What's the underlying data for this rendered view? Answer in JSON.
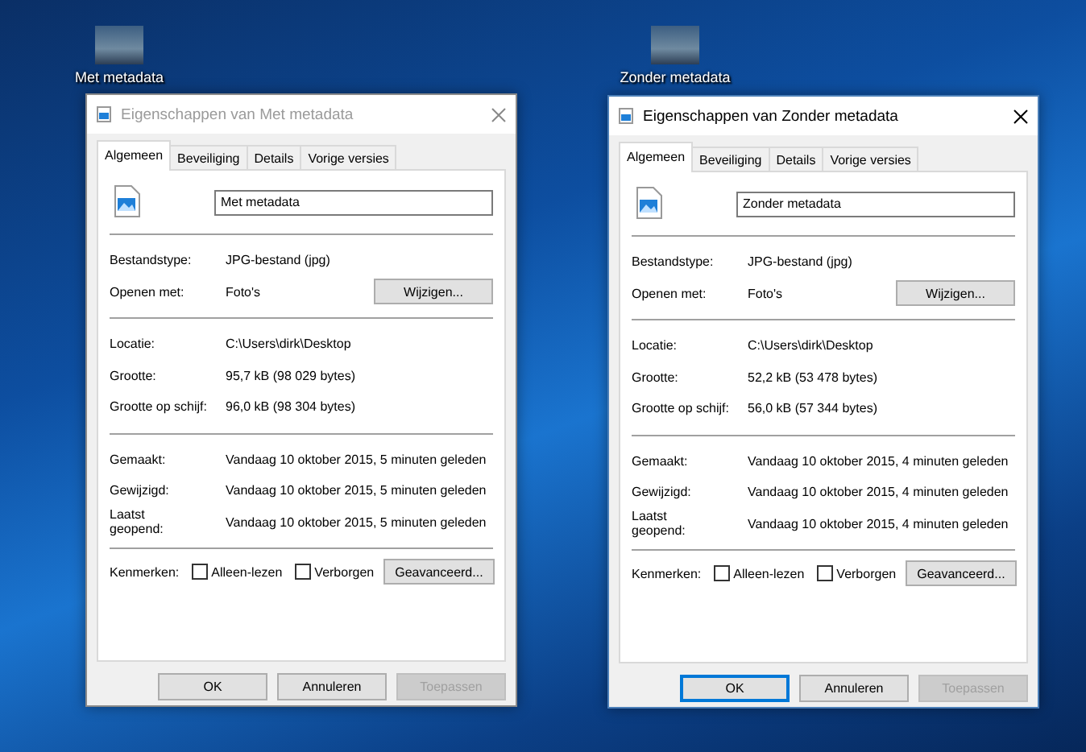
{
  "desktop_icons": [
    {
      "label": "Met metadata"
    },
    {
      "label": "Zonder metadata"
    }
  ],
  "windows": [
    {
      "title": "Eigenschappen van Met metadata",
      "active": false,
      "tabs": [
        {
          "label": "Algemeen",
          "selected": true
        },
        {
          "label": "Beveiliging",
          "selected": false
        },
        {
          "label": "Details",
          "selected": false
        },
        {
          "label": "Vorige versies",
          "selected": false
        }
      ],
      "name_field": {
        "value": "Met metadata"
      },
      "sections": [
        [
          {
            "label": "Bestandstype:",
            "value": "JPG-bestand (jpg)"
          },
          {
            "label": "Openen met:",
            "value": "Foto's",
            "button": "Wijzigen..."
          }
        ],
        [
          {
            "label": "Locatie:",
            "value": "C:\\Users\\dirk\\Desktop"
          },
          {
            "label": "Grootte:",
            "value": "95,7 kB (98 029 bytes)"
          },
          {
            "label": "Grootte op schijf:",
            "value": "96,0 kB (98 304 bytes)"
          }
        ],
        [
          {
            "label": "Gemaakt:",
            "value": "Vandaag 10 oktober 2015, 5 minuten geleden"
          },
          {
            "label": "Gewijzigd:",
            "value": "Vandaag 10 oktober 2015, 5 minuten geleden"
          },
          {
            "label": "Laatst geopend:",
            "value": "Vandaag 10 oktober 2015, 5 minuten geleden"
          }
        ]
      ],
      "attributes": {
        "label": "Kenmerken:",
        "checkboxes": [
          {
            "label": "Alleen-lezen",
            "checked": false
          },
          {
            "label": "Verborgen",
            "checked": false
          }
        ],
        "button": "Geavanceerd..."
      },
      "buttons": [
        {
          "label": "OK",
          "kind": "normal"
        },
        {
          "label": "Annuleren",
          "kind": "normal"
        },
        {
          "label": "Toepassen",
          "kind": "disabled"
        }
      ]
    },
    {
      "title": "Eigenschappen van Zonder metadata",
      "active": true,
      "tabs": [
        {
          "label": "Algemeen",
          "selected": true
        },
        {
          "label": "Beveiliging",
          "selected": false
        },
        {
          "label": "Details",
          "selected": false
        },
        {
          "label": "Vorige versies",
          "selected": false
        }
      ],
      "name_field": {
        "value": "Zonder metadata"
      },
      "sections": [
        [
          {
            "label": "Bestandstype:",
            "value": "JPG-bestand (jpg)"
          },
          {
            "label": "Openen met:",
            "value": "Foto's",
            "button": "Wijzigen..."
          }
        ],
        [
          {
            "label": "Locatie:",
            "value": "C:\\Users\\dirk\\Desktop"
          },
          {
            "label": "Grootte:",
            "value": "52,2 kB (53 478 bytes)"
          },
          {
            "label": "Grootte op schijf:",
            "value": "56,0 kB (57 344 bytes)"
          }
        ],
        [
          {
            "label": "Gemaakt:",
            "value": "Vandaag 10 oktober 2015, 4 minuten geleden"
          },
          {
            "label": "Gewijzigd:",
            "value": "Vandaag 10 oktober 2015, 4 minuten geleden"
          },
          {
            "label": "Laatst geopend:",
            "value": "Vandaag 10 oktober 2015, 4 minuten geleden"
          }
        ]
      ],
      "attributes": {
        "label": "Kenmerken:",
        "checkboxes": [
          {
            "label": "Alleen-lezen",
            "checked": false
          },
          {
            "label": "Verborgen",
            "checked": false
          }
        ],
        "button": "Geavanceerd..."
      },
      "buttons": [
        {
          "label": "OK",
          "kind": "default"
        },
        {
          "label": "Annuleren",
          "kind": "normal"
        },
        {
          "label": "Toepassen",
          "kind": "disabled"
        }
      ]
    }
  ]
}
